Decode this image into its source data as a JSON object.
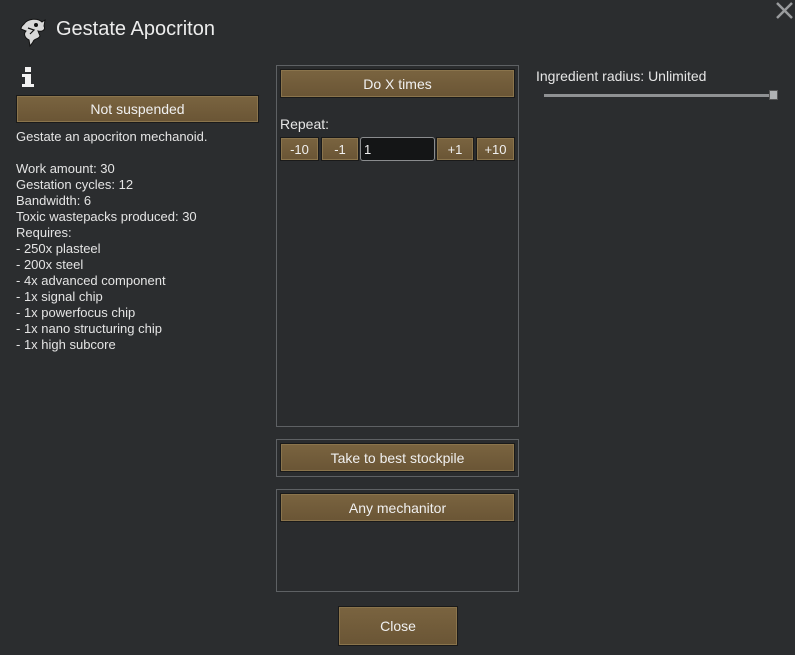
{
  "dialog": {
    "title": "Gestate Apocriton",
    "close_icon": "close-x-icon",
    "title_icon": "mechanoid-apocriton-icon",
    "info_icon": "info-icon"
  },
  "left": {
    "suspend_label": "Not suspended",
    "description": "Gestate an apocriton mechanoid.",
    "stats": [
      "Work amount: 30",
      "Gestation cycles: 12",
      "Bandwidth: 6",
      "Toxic wastepacks produced: 30"
    ],
    "requires_label": "Requires:",
    "requirements": [
      " - 250x plasteel",
      " - 200x steel",
      " - 4x advanced component",
      " - 1x signal chip",
      " - 1x powerfocus chip",
      " - 1x nano structuring chip",
      " - 1x high subcore"
    ]
  },
  "bill": {
    "mode_label": "Do X times",
    "repeat_label": "Repeat:",
    "minus10": "-10",
    "minus1": "-1",
    "count": "1",
    "plus1": "+1",
    "plus10": "+10",
    "store_label": "Take to best stockpile",
    "worker_label": "Any mechanitor"
  },
  "right": {
    "radius_label": "Ingredient radius: Unlimited",
    "radius_fraction": 1.0
  },
  "footer": {
    "close_label": "Close"
  },
  "colors": {
    "background": "#2b2d2f",
    "button": "#6f5a39",
    "panel_border": "#5e6164"
  }
}
